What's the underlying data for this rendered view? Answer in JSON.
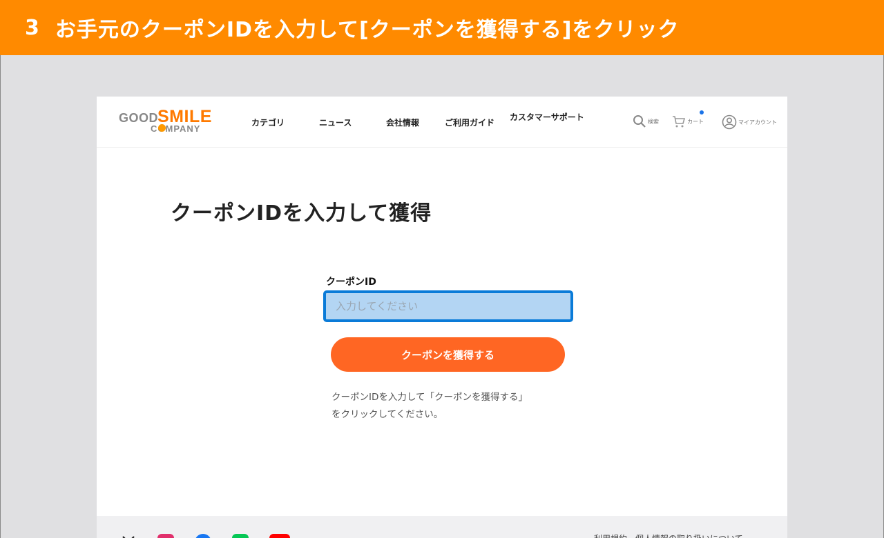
{
  "banner": {
    "step": "3",
    "text": "お手元のクーポンIDを入力して[クーポンを獲得する]をクリック"
  },
  "header": {
    "logo": {
      "line1_a": "GOOD",
      "line1_b": "SMILE",
      "line2": "COMPANY"
    },
    "nav": [
      "カテゴリ",
      "ニュース",
      "会社情報",
      "ご利用ガイド",
      "カスタマーサポート"
    ],
    "search_label": "検索",
    "cart_label": "カート",
    "account_label": "マイアカウント"
  },
  "main": {
    "title": "クーポンIDを入力して獲得",
    "field_label": "クーポンID",
    "input_placeholder": "入力してください",
    "input_value": "",
    "submit_label": "クーポンを獲得する",
    "help_line1": "クーポンIDを入力して「クーポンを獲得する」",
    "help_line2": "をクリックしてください。"
  },
  "footer": {
    "links": "利用規約　個人情報の取り扱いについて"
  },
  "colors": {
    "banner": "#ff8a00",
    "primary_button": "#ff6623",
    "focus_border": "#0a7bd8",
    "input_bg": "#b3d5f3"
  },
  "icons": [
    "search-icon",
    "cart-icon",
    "account-icon",
    "x-icon",
    "instagram-icon",
    "facebook-icon",
    "line-icon",
    "youtube-icon"
  ]
}
